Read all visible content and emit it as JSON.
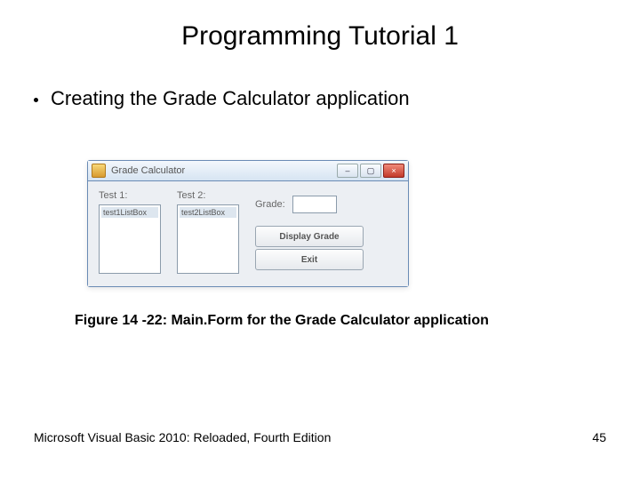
{
  "title": "Programming Tutorial 1",
  "bullet": "Creating the Grade Calculator application",
  "window": {
    "title": "Grade Calculator",
    "test1_label": "Test 1:",
    "test2_label": "Test 2:",
    "list1_item": "test1ListBox",
    "list2_item": "test2ListBox",
    "grade_label": "Grade:",
    "display_btn": "Display Grade",
    "exit_btn": "Exit"
  },
  "caption": "Figure 14 -22: Main.Form for the Grade Calculator application",
  "footer_left": "Microsoft Visual Basic 2010: Reloaded, Fourth Edition",
  "footer_right": "45"
}
